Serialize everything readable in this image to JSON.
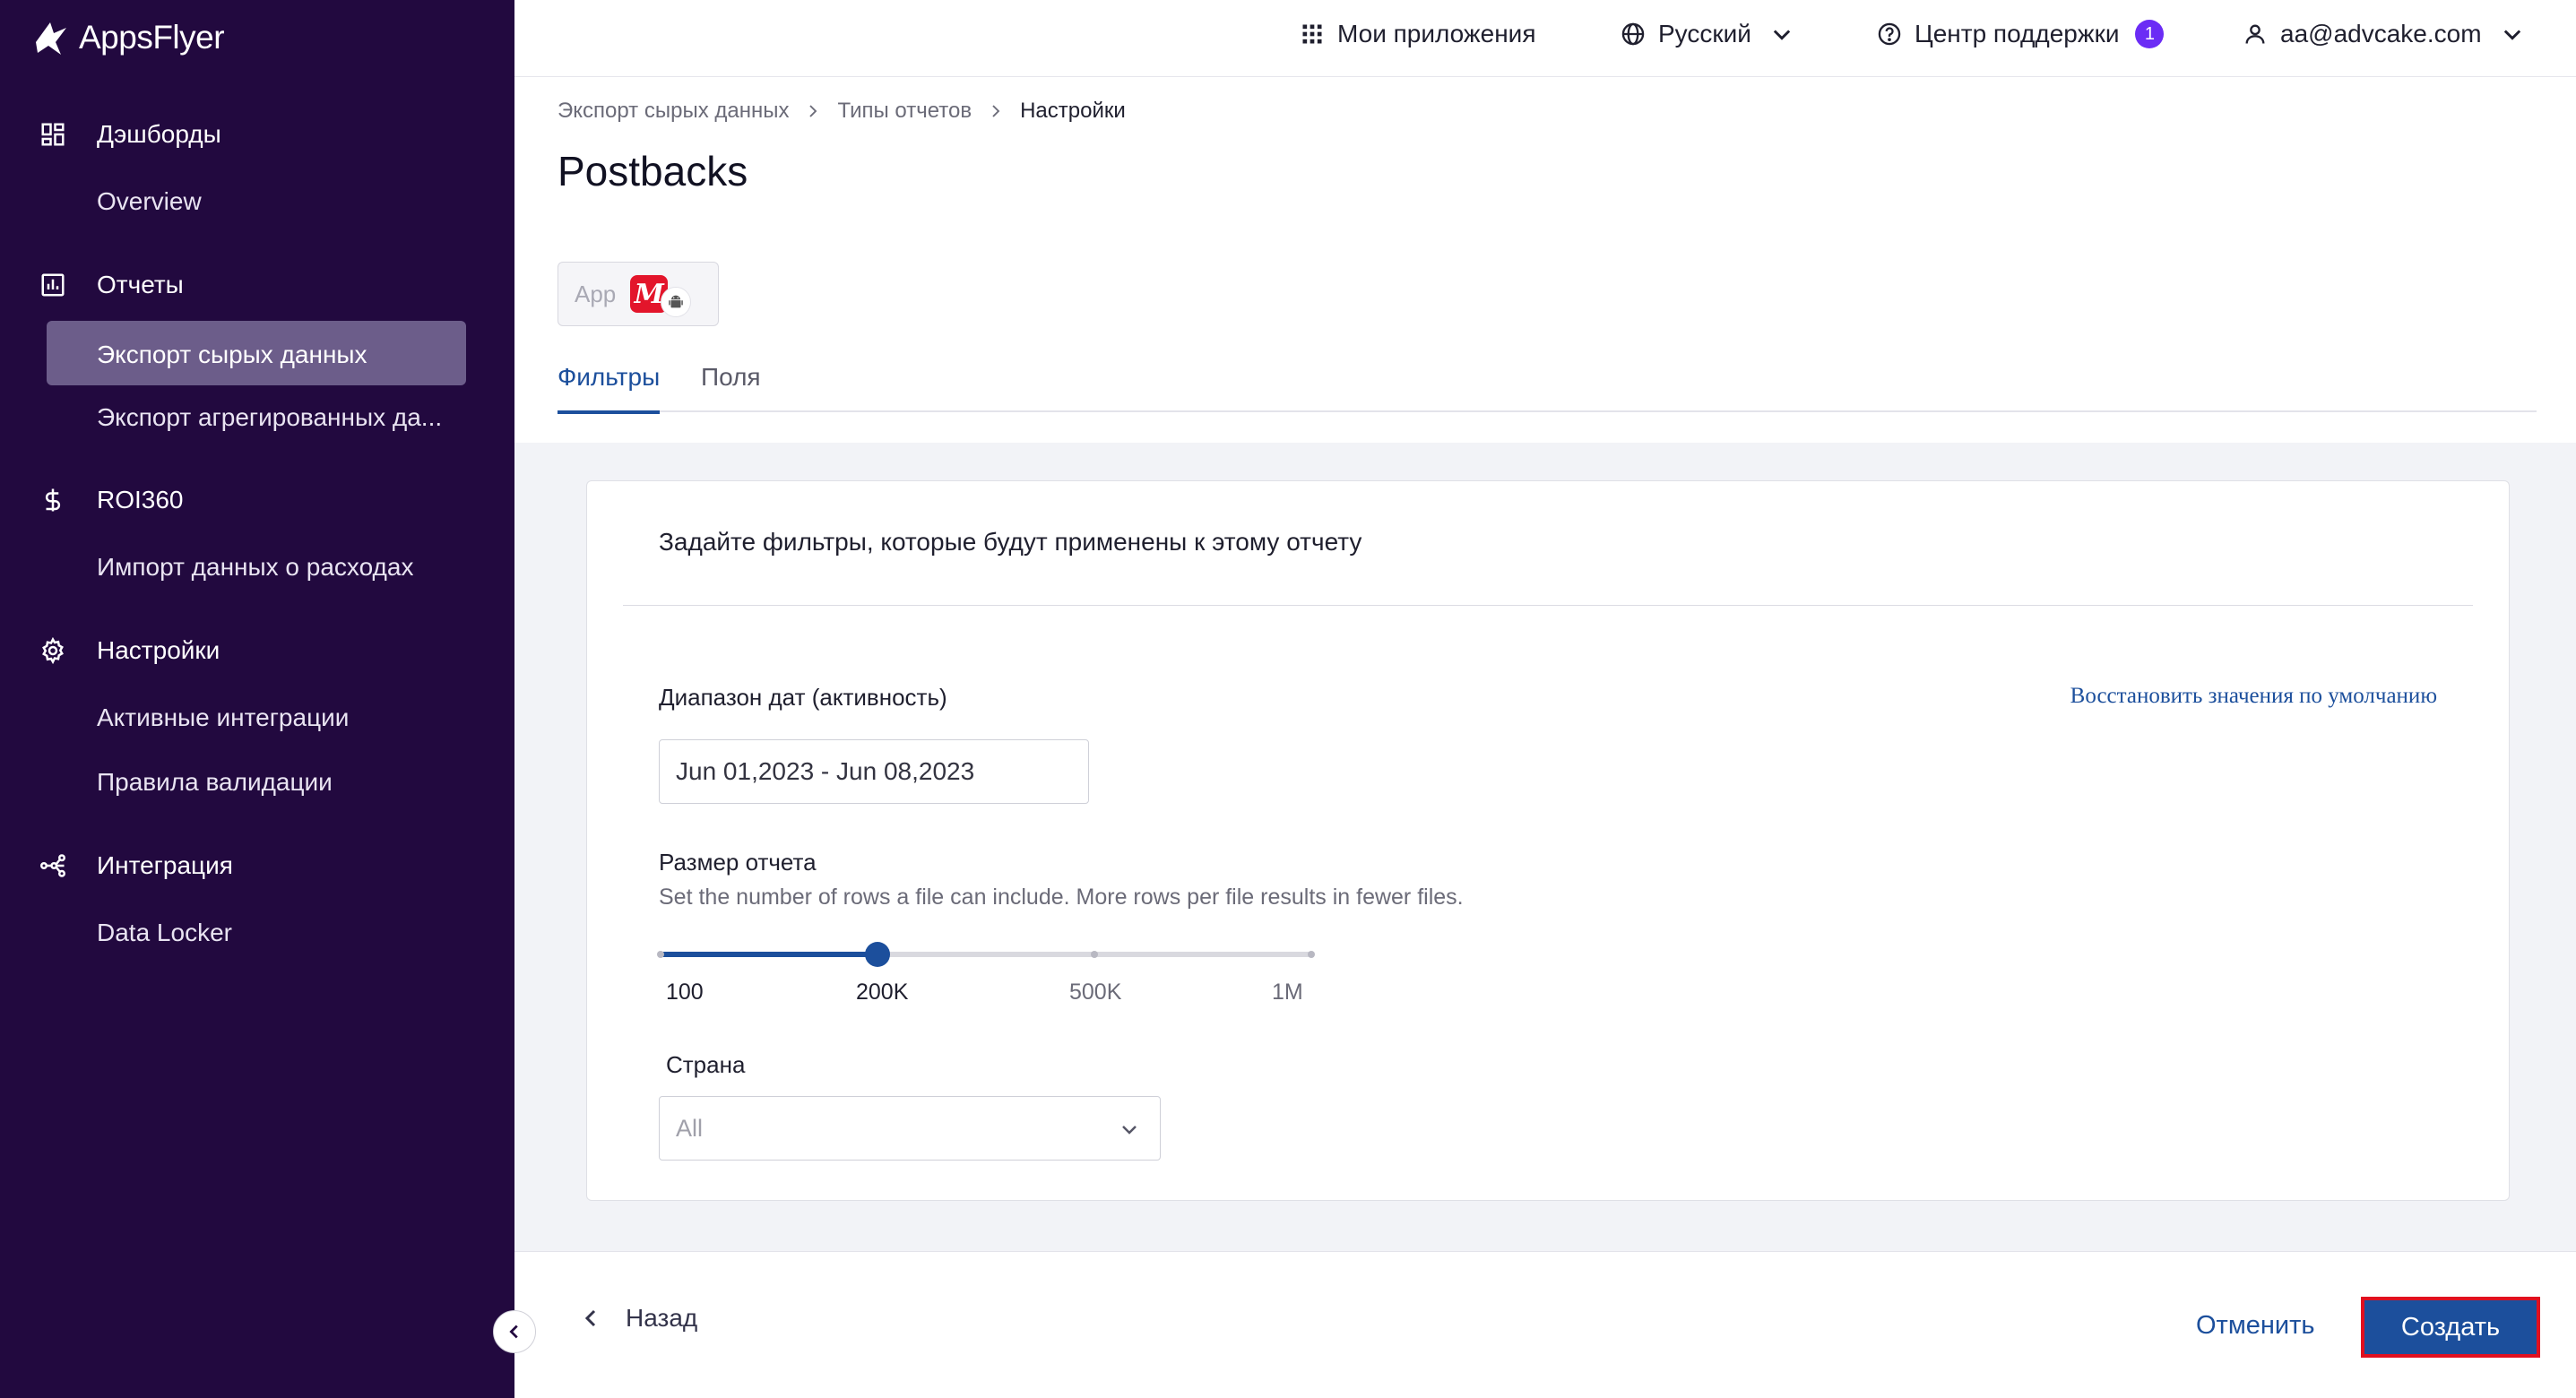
{
  "brand": {
    "name": "AppsFlyer"
  },
  "sidebar": {
    "sections": [
      {
        "label": "Дэшборды",
        "icon": "dashboard-icon",
        "items": [
          {
            "label": "Overview"
          }
        ]
      },
      {
        "label": "Отчеты",
        "icon": "reports-icon",
        "items": [
          {
            "label": "Экспорт сырых данных",
            "active": true
          },
          {
            "label": "Экспорт агрегированных да..."
          }
        ]
      },
      {
        "label": "ROI360",
        "icon": "dollar-icon",
        "items": [
          {
            "label": "Импорт данных о расходах"
          }
        ]
      },
      {
        "label": "Настройки",
        "icon": "gear-icon",
        "items": [
          {
            "label": "Активные интеграции"
          },
          {
            "label": "Правила валидации"
          }
        ]
      },
      {
        "label": "Интеграция",
        "icon": "integration-icon",
        "items": [
          {
            "label": "Data Locker"
          }
        ]
      }
    ]
  },
  "topbar": {
    "my_apps": "Мои приложения",
    "language": "Русский",
    "support": "Центр поддержки",
    "support_badge": "1",
    "account": "aa@advcake.com"
  },
  "breadcrumb": {
    "items": [
      "Экспорт сырых данных",
      "Типы отчетов"
    ],
    "current": "Настройки"
  },
  "page": {
    "title": "Postbacks",
    "app_chip_label": "App",
    "app_logo_letter": "М"
  },
  "tabs": [
    {
      "label": "Фильтры",
      "active": true
    },
    {
      "label": "Поля",
      "active": false
    }
  ],
  "filters": {
    "heading": "Задайте фильтры, которые будут применены к этому отчету",
    "date_range_label": "Диапазон дат (активность)",
    "restore_defaults": "Восстановить значения по умолчанию",
    "date_range_value": "Jun 01,2023 - Jun 08,2023",
    "report_size_label": "Размер отчета",
    "report_size_hint": "Set the number of rows a file can include. More rows per file results in fewer files.",
    "slider": {
      "stops": [
        "100",
        "200K",
        "500K",
        "1M"
      ],
      "selected_index": 1
    },
    "country_label": "Страна",
    "country_value": "All"
  },
  "footer": {
    "back": "Назад",
    "cancel": "Отменить",
    "create": "Создать"
  },
  "colors": {
    "sidebar_bg": "#22093f",
    "accent": "#1c4f9c",
    "badge": "#6b2cf5",
    "highlight_border": "#e0101f"
  }
}
